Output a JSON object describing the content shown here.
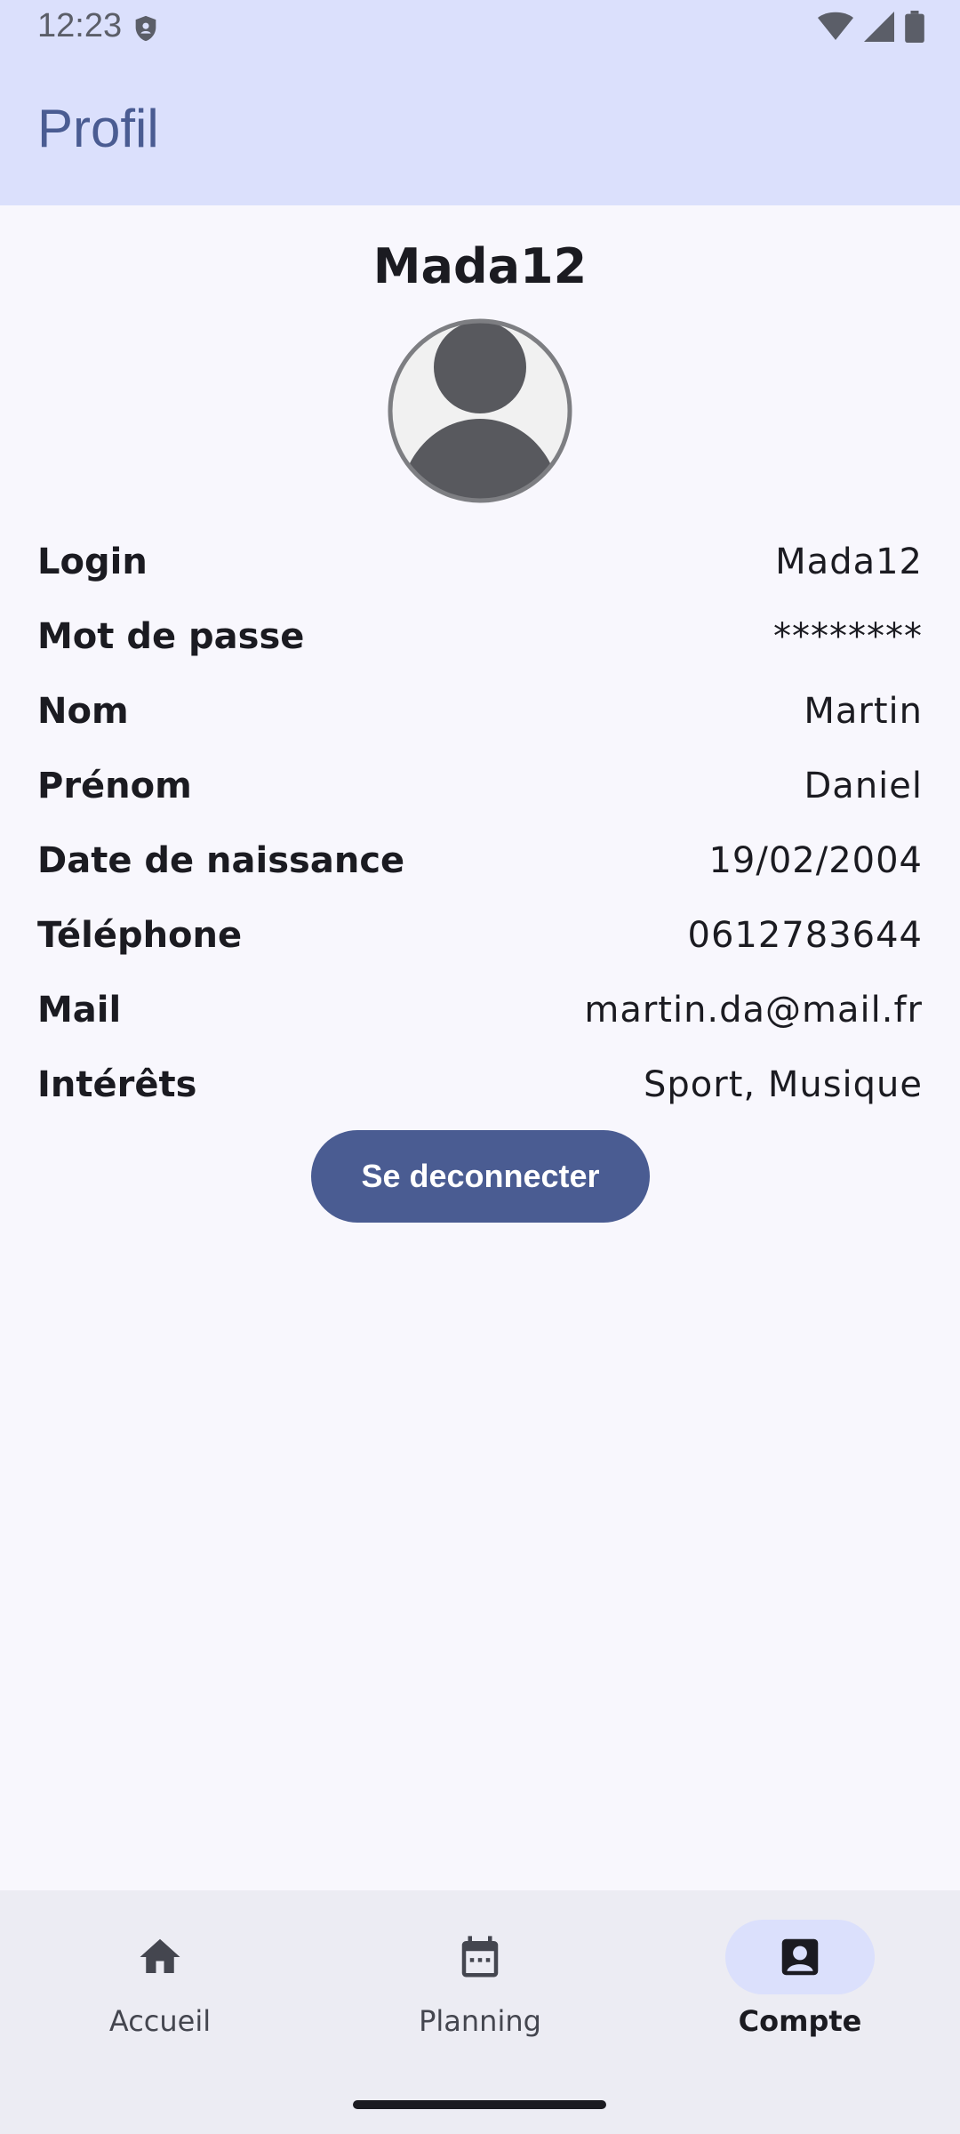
{
  "status_bar": {
    "time": "12:23",
    "icons": [
      "shield-icon",
      "wifi-icon",
      "signal-icon",
      "battery-icon"
    ]
  },
  "app_bar": {
    "title": "Profil"
  },
  "profile": {
    "username": "Mada12",
    "avatar_icon": "person-icon",
    "fields": [
      {
        "label": "Login",
        "value": "Mada12"
      },
      {
        "label": "Mot de passe",
        "value": "********"
      },
      {
        "label": "Nom",
        "value": "Martin"
      },
      {
        "label": "Prénom",
        "value": "Daniel"
      },
      {
        "label": "Date de naissance",
        "value": "19/02/2004"
      },
      {
        "label": "Téléphone",
        "value": "0612783644"
      },
      {
        "label": "Mail",
        "value": "martin.da@mail.fr"
      },
      {
        "label": "Intérêts",
        "value": "Sport, Musique"
      }
    ],
    "logout_label": "Se deconnecter"
  },
  "bottom_nav": {
    "items": [
      {
        "label": "Accueil",
        "icon": "home-icon",
        "active": false
      },
      {
        "label": "Planning",
        "icon": "calendar-icon",
        "active": false
      },
      {
        "label": "Compte",
        "icon": "account-box-icon",
        "active": true
      }
    ]
  },
  "colors": {
    "accent": "#4a5c92",
    "app_bar_bg": "#dbe0fc",
    "background": "#f8f7fd",
    "nav_bg": "#ececf3"
  }
}
